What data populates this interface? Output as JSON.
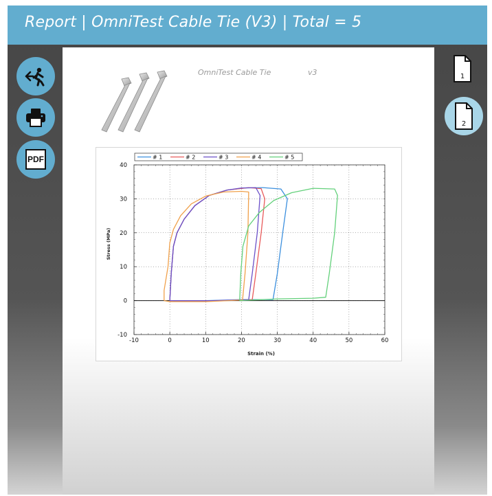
{
  "header": {
    "title": "Report | OmniTest Cable Tie (V3) | Total = 5"
  },
  "toolbar": {
    "exit": {
      "icon": "exit-icon"
    },
    "print": {
      "icon": "printer-icon"
    },
    "pdf": {
      "label": "PDF",
      "icon": "pdf-icon"
    }
  },
  "document": {
    "title": "OmniTest Cable Tie",
    "version": "v3"
  },
  "pages": [
    {
      "label": "1",
      "active": false
    },
    {
      "label": "2",
      "active": true
    }
  ],
  "colors": {
    "accent": "#62adcf",
    "series": [
      "#3b8fde",
      "#e85a5a",
      "#6a4fc8",
      "#f0a04a",
      "#62d07a"
    ]
  },
  "chart_data": {
    "type": "line",
    "xlabel": "Strain (%)",
    "ylabel": "Stress (MPa)",
    "xlim": [
      -10,
      60
    ],
    "ylim": [
      -10,
      40
    ],
    "xticks": [
      -10,
      0,
      10,
      20,
      30,
      40,
      50,
      60
    ],
    "yticks": [
      -10,
      0,
      10,
      20,
      30,
      40
    ],
    "grid": true,
    "legend_position": "top",
    "series": [
      {
        "name": "# 1",
        "points": [
          [
            0,
            0
          ],
          [
            0.4,
            8
          ],
          [
            1,
            16
          ],
          [
            2,
            20
          ],
          [
            4,
            24
          ],
          [
            7,
            28
          ],
          [
            11,
            31
          ],
          [
            16,
            32.6
          ],
          [
            21,
            33.2
          ],
          [
            26,
            33.3
          ],
          [
            31,
            32.9
          ],
          [
            32.8,
            30
          ],
          [
            31.5,
            20
          ],
          [
            30,
            8
          ],
          [
            28.8,
            0.3
          ],
          [
            20,
            0.3
          ],
          [
            10,
            0
          ],
          [
            1,
            0
          ]
        ]
      },
      {
        "name": "# 2",
        "points": [
          [
            0,
            0
          ],
          [
            0.4,
            8
          ],
          [
            1,
            16
          ],
          [
            2,
            20
          ],
          [
            4,
            24
          ],
          [
            7,
            28
          ],
          [
            11,
            31
          ],
          [
            16,
            32.6
          ],
          [
            22,
            33.3
          ],
          [
            25.5,
            33
          ],
          [
            26.5,
            30
          ],
          [
            25.5,
            20
          ],
          [
            24,
            8
          ],
          [
            23,
            0.3
          ],
          [
            14,
            0
          ],
          [
            0,
            0
          ]
        ]
      },
      {
        "name": "# 3",
        "points": [
          [
            0,
            0
          ],
          [
            0.4,
            8
          ],
          [
            1,
            16
          ],
          [
            2,
            20
          ],
          [
            4,
            24
          ],
          [
            7,
            28
          ],
          [
            11,
            31
          ],
          [
            16,
            32.6
          ],
          [
            20,
            33.2
          ],
          [
            24,
            33.3
          ],
          [
            25.2,
            31
          ],
          [
            24.4,
            20
          ],
          [
            23,
            8
          ],
          [
            22,
            0.3
          ],
          [
            12,
            0
          ],
          [
            0,
            0
          ]
        ]
      },
      {
        "name": "# 4",
        "points": [
          [
            -1.6,
            0
          ],
          [
            -1.6,
            3
          ],
          [
            -0.5,
            10
          ],
          [
            0,
            17
          ],
          [
            1,
            21
          ],
          [
            3,
            25
          ],
          [
            6,
            28.5
          ],
          [
            10,
            30.8
          ],
          [
            15,
            32
          ],
          [
            20,
            32.2
          ],
          [
            22,
            32
          ],
          [
            21.8,
            20
          ],
          [
            21,
            8
          ],
          [
            20.3,
            0.2
          ],
          [
            10,
            -0.3
          ],
          [
            0,
            -0.3
          ],
          [
            -1.6,
            0
          ]
        ]
      },
      {
        "name": "# 5",
        "points": [
          [
            19.5,
            0
          ],
          [
            19.8,
            8
          ],
          [
            20.4,
            16
          ],
          [
            22,
            22
          ],
          [
            25,
            26
          ],
          [
            29,
            29.5
          ],
          [
            34,
            31.8
          ],
          [
            40,
            33.1
          ],
          [
            46,
            32.9
          ],
          [
            46.8,
            31
          ],
          [
            46,
            20
          ],
          [
            44.5,
            8
          ],
          [
            43.5,
            1
          ],
          [
            40,
            0.7
          ],
          [
            30,
            0.5
          ],
          [
            19.5,
            0
          ]
        ]
      }
    ]
  }
}
